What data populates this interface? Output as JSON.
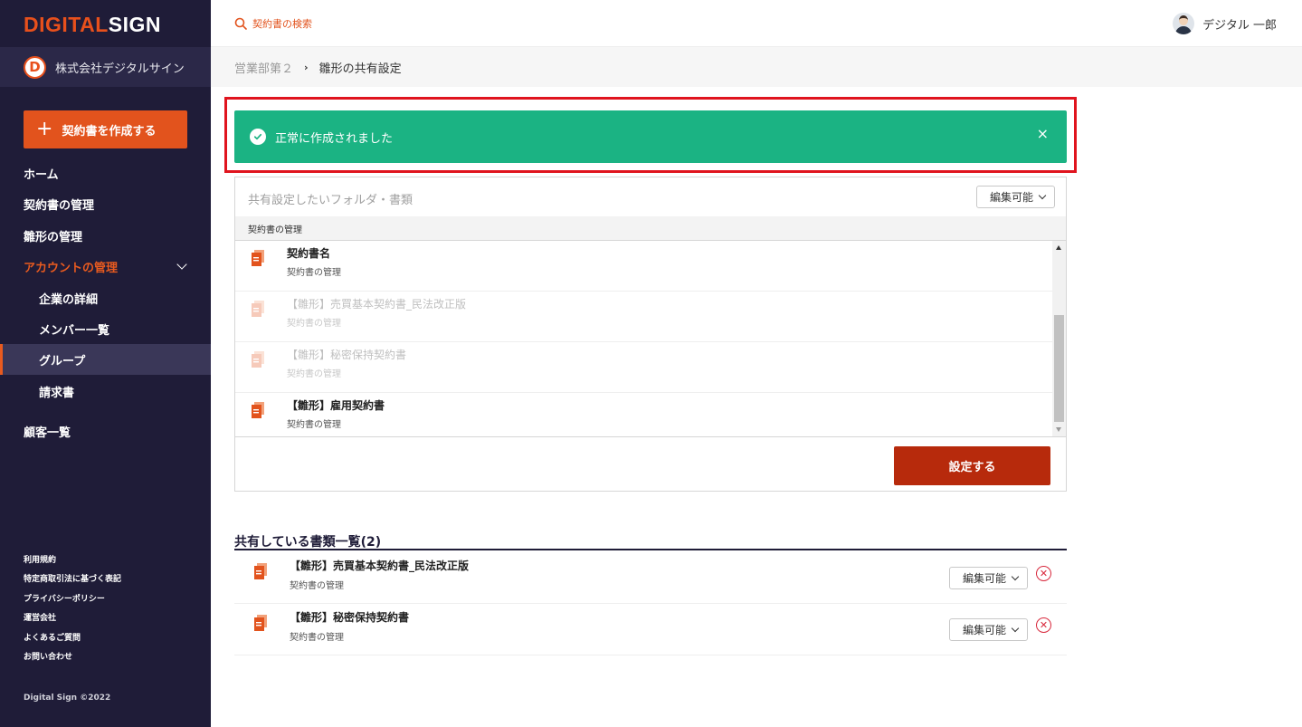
{
  "brand": {
    "logo_part1": "DIGIT",
    "logo_part2": "AL",
    "logo_part3": "SIGN",
    "company_initial": "D",
    "company_name": "株式会社デジタルサイン",
    "accent_color": "#e2531d",
    "sidebar_color": "#1f1c38"
  },
  "sidebar": {
    "create_button": {
      "icon": "plus-icon",
      "label": "契約書を作成する"
    },
    "nav": [
      {
        "label": "ホーム"
      },
      {
        "label": "契約書の管理"
      },
      {
        "label": "雛形の管理"
      },
      {
        "label": "アカウントの管理",
        "expanded": true
      },
      {
        "label": "企業の詳細"
      },
      {
        "label": "メンバー一覧"
      },
      {
        "label": "グループ",
        "active": true
      },
      {
        "label": "請求書"
      },
      {
        "label": "顧客一覧"
      }
    ],
    "footer_links": [
      "利用規約",
      "特定商取引法に基づく表記",
      "プライバシーポリシー",
      "運営会社",
      "よくあるご質問",
      "お問い合わせ"
    ],
    "copyright": "Digital Sign ©2022"
  },
  "header": {
    "search_label": "契約書の検索",
    "user_name": "デジタル 一郎"
  },
  "breadcrumb": {
    "parent": "営業部第２",
    "separator": "›",
    "current": "雛形の共有設定"
  },
  "alert": {
    "message": "正常に作成されました",
    "close": "×",
    "color": "#1bb383"
  },
  "share_form": {
    "heading": "共有設定したいフォルダ・書類",
    "permission": "編集可能",
    "folder_path": "契約書の管理",
    "items": [
      {
        "title": "契約書名",
        "folder": "契約書の管理",
        "enabled": true
      },
      {
        "title": "【雛形】売買基本契約書_民法改正版",
        "folder": "契約書の管理",
        "enabled": false
      },
      {
        "title": "【雛形】秘密保持契約書",
        "folder": "契約書の管理",
        "enabled": false
      },
      {
        "title": "【雛形】雇用契約書",
        "folder": "契約書の管理",
        "enabled": true
      }
    ],
    "submit_label": "設定する"
  },
  "shared_list": {
    "title": "共有している書類一覧(2)",
    "items": [
      {
        "title": "【雛形】売買基本契約書_民法改正版",
        "folder": "契約書の管理",
        "permission": "編集可能"
      },
      {
        "title": "【雛形】秘密保持契約書",
        "folder": "契約書の管理",
        "permission": "編集可能"
      }
    ]
  }
}
